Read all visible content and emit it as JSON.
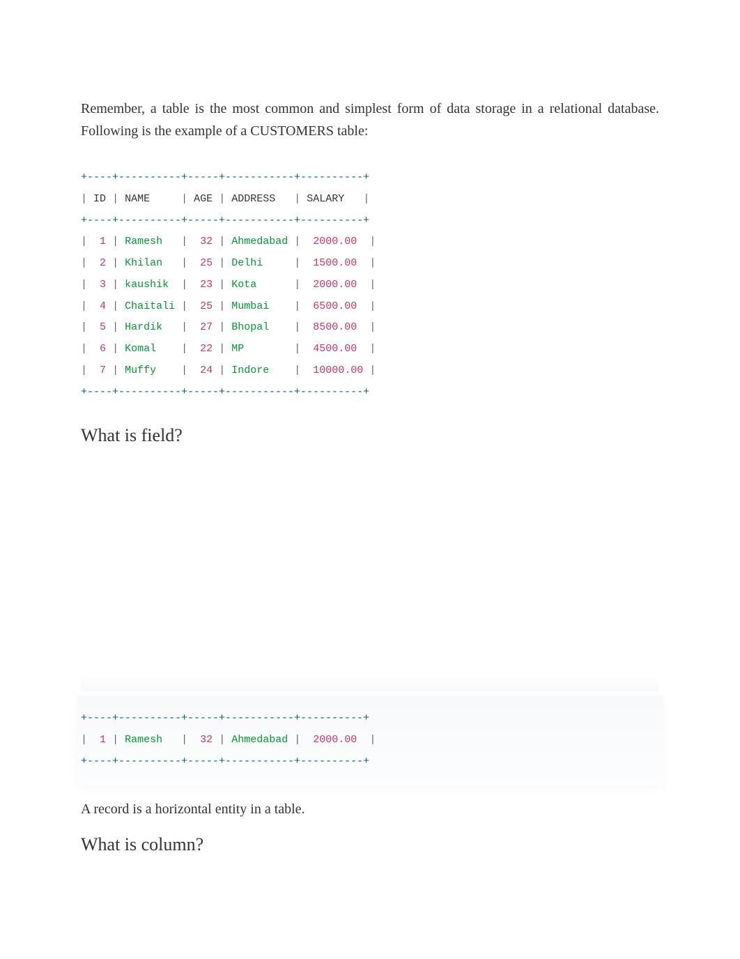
{
  "intro": "Remember, a table is the most common and simplest form of data storage in a relational database. Following is the example of a CUSTOMERS table:",
  "table": {
    "border": "+----+----------+-----+-----------+----------+",
    "headers": [
      "ID",
      "NAME",
      "AGE",
      "ADDRESS",
      "SALARY"
    ],
    "rows": [
      {
        "id": "1",
        "name": "Ramesh",
        "age": "32",
        "address": "Ahmedabad",
        "salary": "2000.00"
      },
      {
        "id": "2",
        "name": "Khilan",
        "age": "25",
        "address": "Delhi",
        "salary": "1500.00"
      },
      {
        "id": "3",
        "name": "kaushik",
        "age": "23",
        "address": "Kota",
        "salary": "2000.00"
      },
      {
        "id": "4",
        "name": "Chaitali",
        "age": "25",
        "address": "Mumbai",
        "salary": "6500.00"
      },
      {
        "id": "5",
        "name": "Hardik",
        "age": "27",
        "address": "Bhopal",
        "salary": "8500.00"
      },
      {
        "id": "6",
        "name": "Komal",
        "age": "22",
        "address": "MP",
        "salary": "4500.00"
      },
      {
        "id": "7",
        "name": "Muffy",
        "age": "24",
        "address": "Indore",
        "salary": "10000.00"
      }
    ]
  },
  "heading_field": "What is field?",
  "record_row": {
    "id": "1",
    "name": "Ramesh",
    "age": "32",
    "address": "Ahmedabad",
    "salary": "2000.00"
  },
  "record_para": "A record is a horizontal entity in a table.",
  "heading_column": "What is column?"
}
